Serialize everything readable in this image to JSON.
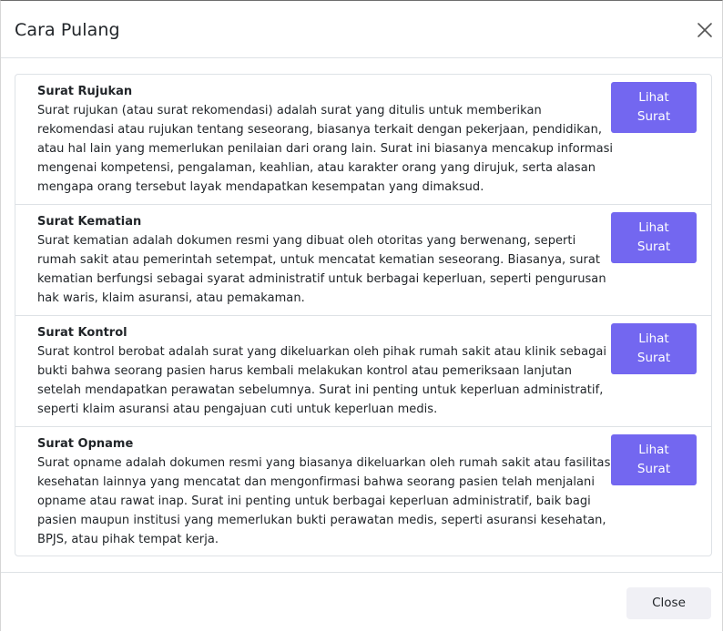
{
  "modal": {
    "title": "Cara Pulang",
    "close_icon": "close-x-icon",
    "footer_close_label": "Close"
  },
  "items": [
    {
      "title": "Surat Rujukan",
      "description": "Surat rujukan (atau surat rekomendasi) adalah surat yang ditulis untuk memberikan rekomendasi atau rujukan tentang seseorang, biasanya terkait dengan pekerjaan, pendidikan, atau hal lain yang memerlukan penilaian dari orang lain. Surat ini biasanya mencakup informasi mengenai kompetensi, pengalaman, keahlian, atau karakter orang yang dirujuk, serta alasan mengapa orang tersebut layak mendapatkan kesempatan yang dimaksud.",
      "button_line1": "Lihat",
      "button_line2": "Surat"
    },
    {
      "title": "Surat Kematian",
      "description": "Surat kematian adalah dokumen resmi yang dibuat oleh otoritas yang berwenang, seperti rumah sakit atau pemerintah setempat, untuk mencatat kematian seseorang. Biasanya, surat kematian berfungsi sebagai syarat administratif untuk berbagai keperluan, seperti pengurusan hak waris, klaim asuransi, atau pemakaman.",
      "button_line1": "Lihat",
      "button_line2": "Surat"
    },
    {
      "title": "Surat Kontrol",
      "description": "Surat kontrol berobat adalah surat yang dikeluarkan oleh pihak rumah sakit atau klinik sebagai bukti bahwa seorang pasien harus kembali melakukan kontrol atau pemeriksaan lanjutan setelah mendapatkan perawatan sebelumnya. Surat ini penting untuk keperluan administratif, seperti klaim asuransi atau pengajuan cuti untuk keperluan medis.",
      "button_line1": "Lihat",
      "button_line2": "Surat"
    },
    {
      "title": "Surat Opname",
      "description": "Surat opname adalah dokumen resmi yang biasanya dikeluarkan oleh rumah sakit atau fasilitas kesehatan lainnya yang mencatat dan mengonfirmasi bahwa seorang pasien telah menjalani opname atau rawat inap. Surat ini penting untuk berbagai keperluan administratif, baik bagi pasien maupun institusi yang memerlukan bukti perawatan medis, seperti asuransi kesehatan, BPJS, atau pihak tempat kerja.",
      "button_line1": "Lihat",
      "button_line2": "Surat"
    }
  ],
  "colors": {
    "accent": "#7367f0",
    "border": "#dee2e6",
    "text": "#212529",
    "footer_button_bg": "#f0f0f5"
  }
}
